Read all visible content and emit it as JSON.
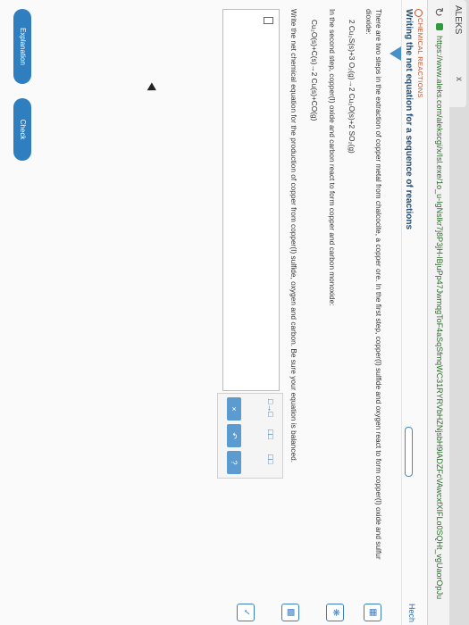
{
  "browser": {
    "tab_title": "ALEKS",
    "tab_close": "x",
    "reload_icon": "reload-icon",
    "url": "https://www.aleks.com/alekscgi/x/Isl.exe/1o_u-IgNslkr7j8P3jH-lBjuPp47JwmqgToF4aSqSfmqWC31RYRVbHZNjsbH9lADZFcVAwcxfXIFLo0SQHt_vgUaorOpJu"
  },
  "header": {
    "topic": "CHEMICAL REACTIONS",
    "title": "Writing the net equation for a sequence of reactions",
    "progress": 0.0,
    "help_label": "Hech"
  },
  "problem": {
    "para1": "There are two steps in the extraction of copper metal from chalcocite, a copper ore. In the first step, copper(I) sulfide and oxygen react to form copper(I) oxide and sulfur dioxide:",
    "eq1": "2 Cu₂S(s)+3 O₂(g)→2 Cu₂O(s)+2 SO₂(g)",
    "para2": "In the second step, copper(I) oxide and carbon react to form copper and carbon monoxide:",
    "eq2": "Cu₂O(s)+C(s)→2 Cu(s)+CO(g)",
    "para3": "Write the net chemical equation for the production of copper from copper(I) sulfide, oxygen and carbon. Be sure your equation is balanced."
  },
  "palette": {
    "arrow": "□→□",
    "sub": "□□",
    "sup": "□□",
    "clear": "×",
    "undo": "↶",
    "help": "?"
  },
  "footer": {
    "explanation": "Explanation",
    "check": "Check"
  }
}
